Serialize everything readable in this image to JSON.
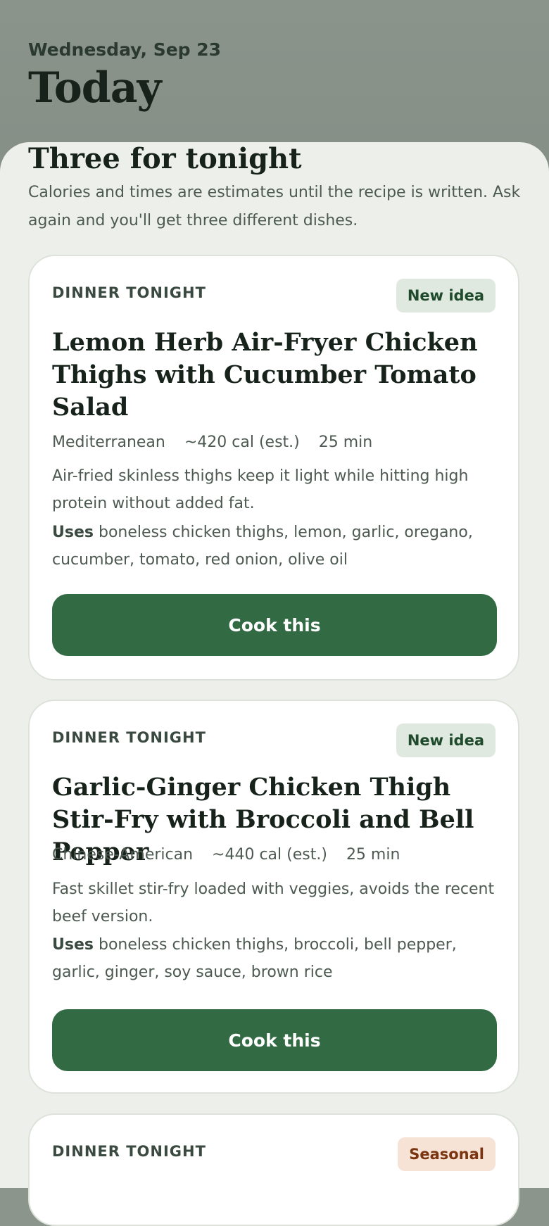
{
  "header": {
    "date": "Wednesday, Sep 23",
    "title": "Today"
  },
  "section": {
    "title": "Three for tonight",
    "subtitle": "Calories and times are estimates until the recipe is written. Ask again and you'll get three different dishes."
  },
  "cards": [
    {
      "eyebrow": "DINNER TONIGHT",
      "badge": "New idea",
      "title": "Lemon Herb Air-Fryer Chicken Thighs with Cucumber Tomato Salad",
      "cuisine": "Mediterranean",
      "calories": "~420 cal (est.)",
      "time": "25 min",
      "description": "Air-fried skinless thighs keep it light while hitting high protein without added fat.",
      "uses_label": "Uses",
      "uses": "boneless chicken thighs, lemon, garlic, oregano, cucumber, tomato, red onion, olive oil",
      "button": "Cook this"
    },
    {
      "eyebrow": "DINNER TONIGHT",
      "badge": "New idea",
      "title": "Garlic-Ginger Chicken Thigh Stir-Fry with Broccoli and Bell Pepper",
      "cuisine": "Chinese-American",
      "calories": "~440 cal (est.)",
      "time": "25 min",
      "description": "Fast skillet stir-fry loaded with veggies, avoids the recent beef version.",
      "uses_label": "Uses",
      "uses": "boneless chicken thighs, broccoli, bell pepper, garlic, ginger, soy sauce, brown rice",
      "button": "Cook this"
    },
    {
      "eyebrow": "DINNER TONIGHT",
      "badge": "Seasonal"
    }
  ],
  "colors": {
    "accent": "#316a43",
    "header_bg": "#8a948b",
    "sheet_bg": "#edf0ea",
    "badge_new_bg": "#dfe9df",
    "badge_seasonal_bg": "#f6e3d6"
  }
}
